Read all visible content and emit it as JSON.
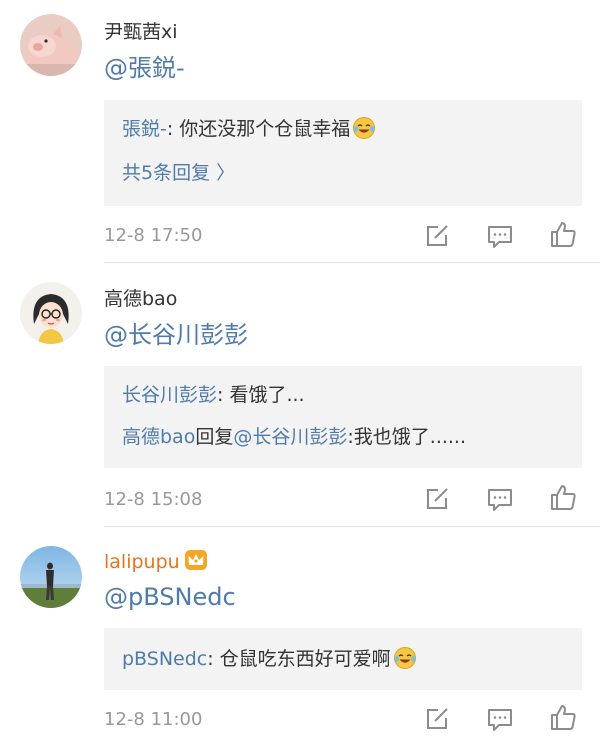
{
  "comments": [
    {
      "username": "尹甄茜xi",
      "mention": "@張鋭-",
      "reply": {
        "line1_name": "張鋭-",
        "line1_text": ": 你还没那个仓鼠幸福",
        "more_label": "共5条回复 〉"
      },
      "time": "12-8 17:50"
    },
    {
      "username": "高德bao",
      "mention": "@长谷川彭彭",
      "reply": {
        "line1_name": "长谷川彭彭",
        "line1_text": ": 看饿了...",
        "line2_name": "高德bao",
        "line2_mid": "回复",
        "line2_mention": "@长谷川彭彭",
        "line2_text": ":我也饿了......"
      },
      "time": "12-8 15:08"
    },
    {
      "username": "lalipupu",
      "mention": "@pBSNedc",
      "reply": {
        "line1_name": "pBSNedc",
        "line1_text": ": 仓鼠吃东西好可爱啊"
      },
      "time": "12-8 11:00"
    }
  ],
  "icons": {
    "repost": "share-edit-icon",
    "comment": "comment-icon",
    "like": "thumbs-up-icon",
    "vip": "crown-icon"
  },
  "colors": {
    "link": "#4f7bab",
    "time": "#999999",
    "reply_bg": "#f3f3f3",
    "vip": "#f5a623"
  }
}
